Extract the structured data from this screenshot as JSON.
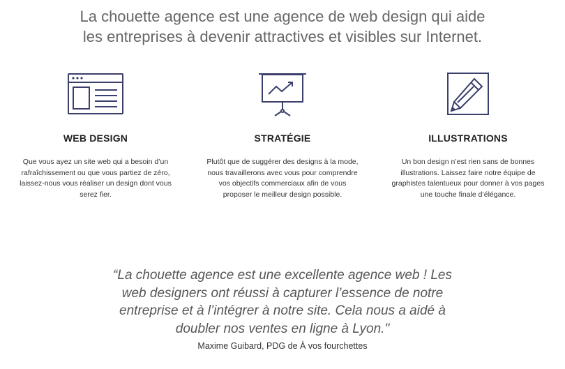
{
  "intro": {
    "line1": "La chouette agence est une agence de web design qui aide",
    "line2": "les entreprises à devenir attractives et visibles sur Internet."
  },
  "services": [
    {
      "icon": "browser-window-icon",
      "title": "WEB DESIGN",
      "desc": [
        "Que vous ayez un site web qui a besoin d’un",
        "rafraîchissement ou que vous partiez de zéro,",
        "laissez-nous vous réaliser un design dont vous",
        "serez fier."
      ]
    },
    {
      "icon": "presentation-chart-icon",
      "title": "STRATÉGIE",
      "desc": [
        "Plutôt que de suggérer des designs à la mode,",
        "nous travaillerons avec vous pour comprendre",
        "vos objectifs commerciaux afin de vous",
        "proposer le meilleur design possible."
      ]
    },
    {
      "icon": "pencil-icon",
      "title": "ILLUSTRATIONS",
      "desc": [
        "Un bon design n’est rien sans de bonnes",
        "illustrations. Laissez faire notre équipe de",
        "graphistes talentueux pour donner à vos pages",
        "une touche finale d’élégance."
      ]
    }
  ],
  "testimonial": {
    "quote": [
      "“La chouette agence est une excellente agence web ! Les",
      "web designers ont réussi à capturer l’essence de notre",
      "entreprise et à l’intégrer à notre site. Cela nous a aidé à",
      "doubler nos ventes en ligne à Lyon.\""
    ],
    "author": "Maxime Guibard, PDG de À vos fourchettes"
  },
  "colors": {
    "icon_stroke": "#3a3f6b",
    "intro_text": "#666666",
    "quote_text": "#555555"
  }
}
